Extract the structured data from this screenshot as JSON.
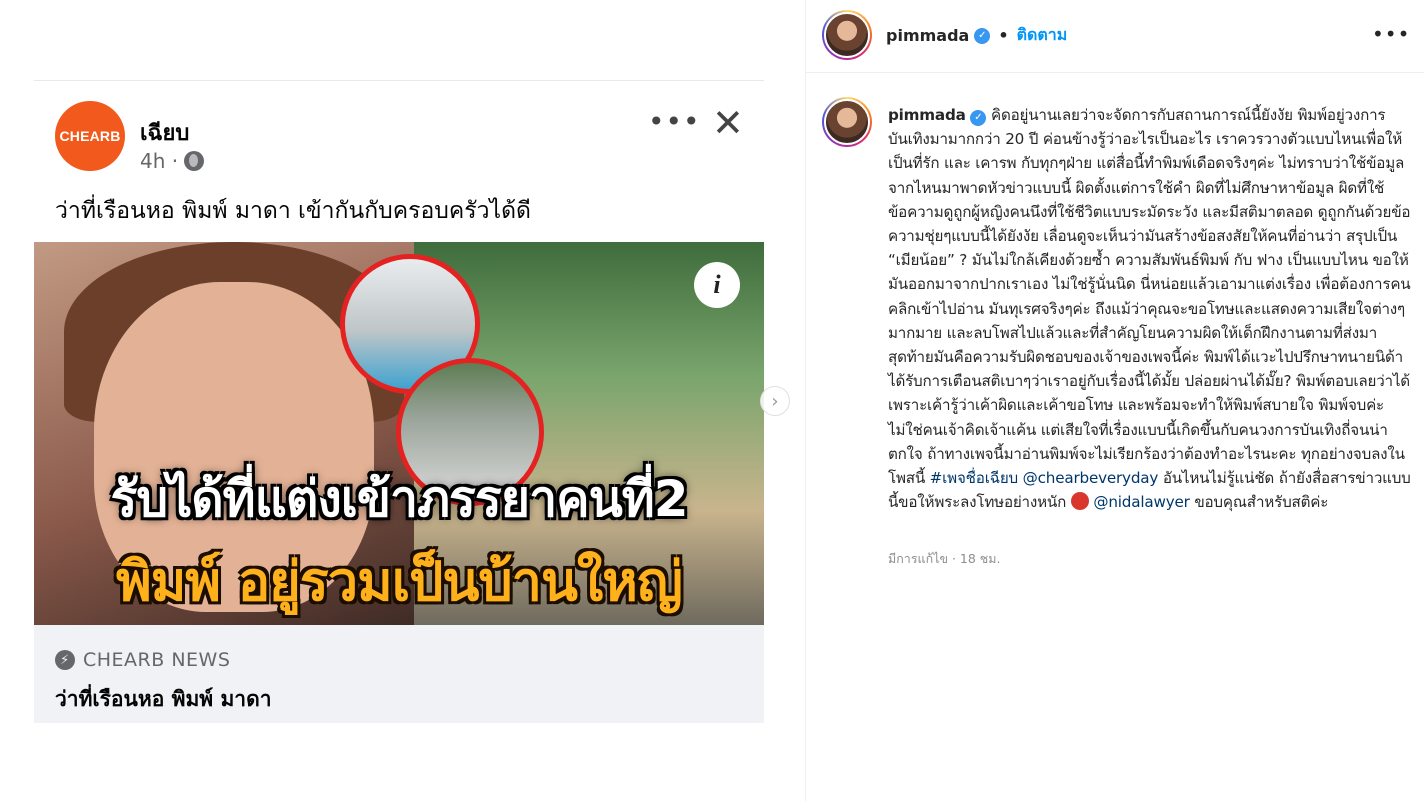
{
  "media": {
    "fb_post": {
      "logo_text": "CHEARB",
      "page_name": "เฉียบ",
      "time": "4h ·",
      "caption": "ว่าที่เรือนหอ พิมพ์ มาดา เข้ากันกับครอบครัวได้ดี",
      "image_headline_1": "รับได้ที่แต่งเข้าภรรยาคนที่2",
      "image_headline_2": "พิมพ์ อยู่รวมเป็นบ้านใหญ่",
      "info_glyph": "i",
      "source": "CHEARB NEWS",
      "link_title": "ว่าที่เรือนหอ พิมพ์ มาดา"
    },
    "next_glyph": "›"
  },
  "panel": {
    "username": "pimmada",
    "verified_glyph": "✓",
    "dot": "•",
    "follow_label": "ติดตาม",
    "more_glyph": "•••",
    "comment": {
      "author": "pimmada",
      "text_1": "คิดอยู่นานเลยว่าจะจัดการกับสถานการณ์นี้ยังงัย พิมพ์อยู่วงการบันเทิงมามากกว่า 20 ปี ค่อนข้างรู้ว่าอะไรเป็นอะไร เราควรวางตัวแบบไหนเพื่อให้เป็นที่รัก และ เคารพ กับทุกๆฝ่าย แต่สื่อนี้ทำพิมพ์เดือดจริงๆค่ะ ไม่ทราบว่าใช้ข้อมูลจากไหนมาพาดหัวข่าวแบบนี้ ผิดตั้งแต่การใช้คำ ผิดที่ไม่ศึกษาหาข้อมูล ผิดที่ใช้ข้อความดูถูกผู้หญิงคนนึงที่ใช้ชีวิตแบบระมัดระวัง และมีสติมาตลอด ดูถูกกันด้วยข้อความชุ่ยๆแบบนี้ได้ยังงัย เลื่อนดูจะเห็นว่ามันสร้างข้อสงสัยให้คนที่อ่านว่า สรุปเป็น “เมียน้อย” ? มันไม่ใกล้เคียงด้วยซ้ำ ความสัมพันธ์พิมพ์ กับ ฟาง เป็นแบบไหน ขอให้มันออกมาจากปากเราเอง ไม่ใช่รู้นั่นนิด นี่หน่อยแล้วเอามาแต่งเรื่อง เพื่อต้องการคนคลิกเข้าไปอ่าน มันทุเรศจริงๆค่ะ ถึงแม้ว่าคุณจะขอโทษและแสดงความเสียใจต่างๆมากมาย และลบโพสไปแล้วและที่สำคัญโยนความผิดให้เด็กฝึกงานตามที่ส่งมา สุดท้ายมันคือความรับผิดชอบของเจ้าของเพจนี้ค่ะ พิมพ์ได้แวะไปปรึกษาทนายนิด้า ได้รับการเตือนสติเบาๆว่าเราอยู่กับเรื่องนี้ได้มั้ย ปล่อยผ่านได้มั๊ย? พิมพ์ตอบเลยว่าได้ เพราะเค้ารู้ว่าเค้าผิดและเค้าขอโทษ และพร้อมจะทำให้พิมพ์สบายใจ พิมพ์จบค่ะ ไม่ใช่คนเจ้าคิดเจ้าแค้น แต่เสียใจที่เรื่องแบบนี้เกิดขึ้นกับคนวงการบันเทิงถี่จนน่าตกใจ ถ้าทางเพจนี้มาอ่านพิมพ์จะไม่เรียกร้องว่าต้องทำอะไรนะคะ ทุกอย่างจบลงในโพสนี้ ",
      "hashtag": "#เพจชื่อเฉียบ",
      "mention_1": "@chearbeveryday",
      "text_2": " อันไหนไม่รู้แน่ชัด ถ้ายังสื่อสารข่าวแบบนี้ขอให้พระลงโทษอย่างหนัก ",
      "mention_2": "@nidalawyer",
      "text_3": " ขอบคุณสำหรับสติค่ะ"
    },
    "edited_meta": "มีการแก้ไข · 18 ชม."
  },
  "colors": {
    "follow_blue": "#0095f6",
    "verified_blue": "#3897f0",
    "link_navy": "#00376b",
    "chearb_orange": "#f25a1d",
    "headline_yellow": "#ffb11c"
  }
}
